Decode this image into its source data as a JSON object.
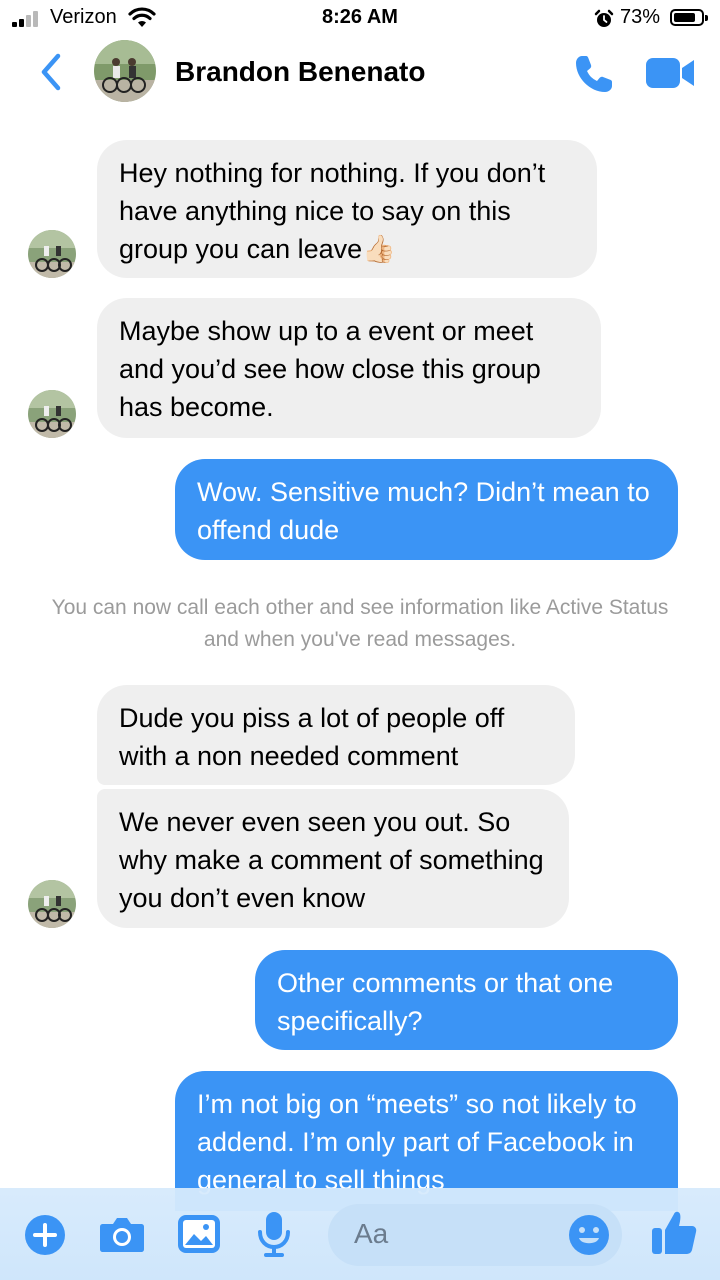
{
  "status_bar": {
    "carrier": "Verizon",
    "time": "8:26 AM",
    "battery": "73%"
  },
  "header": {
    "contact_name": "Brandon Benenato"
  },
  "messages": [
    {
      "from": "them",
      "text": "Hey nothing for nothing. If you don’t have anything nice to say on this group you can leave👍🏻"
    },
    {
      "from": "them",
      "text": "Maybe show up to a event or meet and you’d see how close this group has become."
    },
    {
      "from": "me",
      "text": "Wow. Sensitive much? Didn’t mean to offend dude"
    },
    {
      "from": "them",
      "text": "Dude you piss a lot of people off with a non needed comment"
    },
    {
      "from": "them",
      "text": "We never even seen you out. So why make a comment of something you don’t even know"
    },
    {
      "from": "me",
      "text": "Other comments or that one specifically?"
    },
    {
      "from": "me",
      "text": "I’m not big on “meets” so not likely to addend. I’m only part of Facebook in general to sell things"
    }
  ],
  "system_note": "You can now call each other and see information like Active Status and when you've read messages.",
  "composer": {
    "placeholder": "Aa"
  },
  "colors": {
    "accent": "#3b94f5",
    "incoming_bubble": "#efefef",
    "outgoing_bubble": "#3b94f5"
  }
}
